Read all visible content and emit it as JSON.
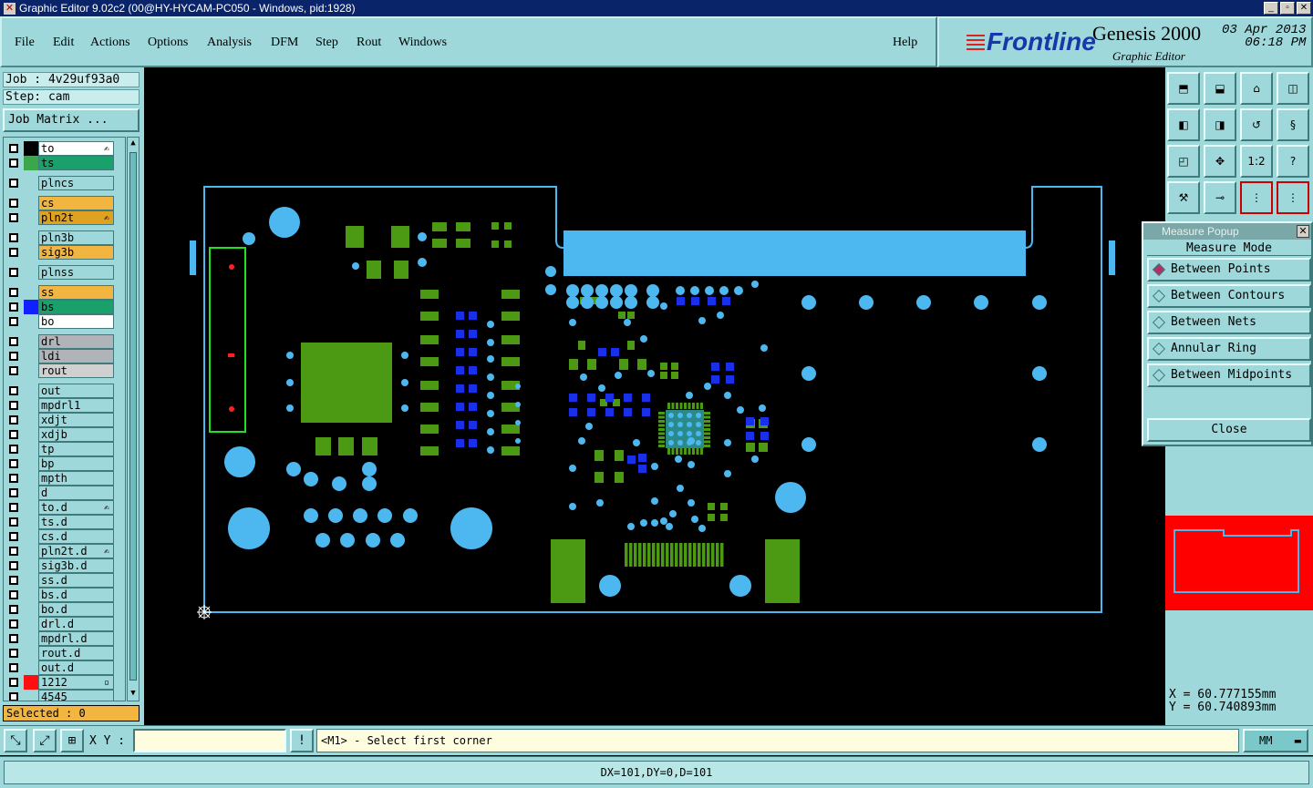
{
  "window": {
    "title": "Graphic Editor 9.02c2 (00@HY-HYCAM-PC050 - Windows, pid:1928)",
    "min": "_",
    "max": "▫",
    "close": "✕"
  },
  "menu": [
    "File",
    "Edit",
    "Actions",
    "Options",
    "Analysis",
    "DFM",
    "Step",
    "Rout",
    "Windows"
  ],
  "help": "Help",
  "brand": {
    "logo": "Frontline",
    "product": "Genesis 2000",
    "subtitle": "Graphic Editor",
    "date": "03 Apr 2013",
    "time": "06:18 PM"
  },
  "job": {
    "job": "Job : 4v29uf93a0",
    "step": "Step: cam",
    "matrix": "Job Matrix ..."
  },
  "layers": [
    {
      "name": "to",
      "color": "#ffffff",
      "swatch": "#000000",
      "mark": "✍"
    },
    {
      "name": "ts",
      "color": "#1aa06a",
      "swatch": "#3aa84a",
      "mark": ""
    },
    {
      "name": "plncs",
      "color": "#9ed8da",
      "swatch": "",
      "mark": ""
    },
    {
      "name": "cs",
      "color": "#f2b540",
      "swatch": "",
      "mark": ""
    },
    {
      "name": "pln2t",
      "color": "#e0a020",
      "swatch": "",
      "mark": "✍"
    },
    {
      "name": "pln3b",
      "color": "#9ed8da",
      "swatch": "",
      "mark": ""
    },
    {
      "name": "sig3b",
      "color": "#f2b540",
      "swatch": "",
      "mark": ""
    },
    {
      "name": "plnss",
      "color": "#9ed8da",
      "swatch": "",
      "mark": ""
    },
    {
      "name": "ss",
      "color": "#f2b540",
      "swatch": "",
      "mark": ""
    },
    {
      "name": "bs",
      "color": "#1aa06a",
      "swatch": "#1020ff",
      "mark": ""
    },
    {
      "name": "bo",
      "color": "#ffffff",
      "swatch": "",
      "mark": ""
    },
    {
      "name": "drl",
      "color": "#b0b4b8",
      "swatch": "",
      "mark": ""
    },
    {
      "name": "ldi",
      "color": "#b0b4b8",
      "swatch": "",
      "mark": ""
    },
    {
      "name": "rout",
      "color": "#d0d0d0",
      "swatch": "",
      "mark": ""
    },
    {
      "name": "out",
      "color": "#9ed8da",
      "swatch": "",
      "mark": ""
    },
    {
      "name": "mpdrl1",
      "color": "#9ed8da",
      "swatch": "",
      "mark": ""
    },
    {
      "name": "xdjt",
      "color": "#9ed8da",
      "swatch": "",
      "mark": ""
    },
    {
      "name": "xdjb",
      "color": "#9ed8da",
      "swatch": "",
      "mark": ""
    },
    {
      "name": "tp",
      "color": "#9ed8da",
      "swatch": "",
      "mark": ""
    },
    {
      "name": "bp",
      "color": "#9ed8da",
      "swatch": "",
      "mark": ""
    },
    {
      "name": "mpth",
      "color": "#9ed8da",
      "swatch": "",
      "mark": ""
    },
    {
      "name": "d",
      "color": "#9ed8da",
      "swatch": "",
      "mark": ""
    },
    {
      "name": "to.d",
      "color": "#9ed8da",
      "swatch": "",
      "mark": "✍"
    },
    {
      "name": "ts.d",
      "color": "#9ed8da",
      "swatch": "",
      "mark": ""
    },
    {
      "name": "cs.d",
      "color": "#9ed8da",
      "swatch": "",
      "mark": ""
    },
    {
      "name": "pln2t.d",
      "color": "#9ed8da",
      "swatch": "",
      "mark": "✍"
    },
    {
      "name": "sig3b.d",
      "color": "#9ed8da",
      "swatch": "",
      "mark": ""
    },
    {
      "name": "ss.d",
      "color": "#9ed8da",
      "swatch": "",
      "mark": ""
    },
    {
      "name": "bs.d",
      "color": "#9ed8da",
      "swatch": "",
      "mark": ""
    },
    {
      "name": "bo.d",
      "color": "#9ed8da",
      "swatch": "",
      "mark": ""
    },
    {
      "name": "drl.d",
      "color": "#9ed8da",
      "swatch": "",
      "mark": ""
    },
    {
      "name": "mpdrl.d",
      "color": "#9ed8da",
      "swatch": "",
      "mark": ""
    },
    {
      "name": "rout.d",
      "color": "#9ed8da",
      "swatch": "",
      "mark": ""
    },
    {
      "name": "out.d",
      "color": "#9ed8da",
      "swatch": "",
      "mark": ""
    },
    {
      "name": "1212",
      "color": "#9ed8da",
      "swatch": "#ff1010",
      "mark": "▫"
    },
    {
      "name": "4545",
      "color": "#9ed8da",
      "swatch": "",
      "mark": ""
    }
  ],
  "selected": "Selected : 0",
  "popup": {
    "title": "Measure Popup",
    "mode": "Measure Mode",
    "options": [
      "Between Points",
      "Between Contours",
      "Between Nets",
      "Annular Ring",
      "Between Midpoints"
    ],
    "active": 0,
    "close": "Close"
  },
  "coords": {
    "x": "X = 60.777155mm",
    "y": "Y = 60.740893mm"
  },
  "xy_label": "X Y :",
  "prompt": "<M1> - Select first corner",
  "unit": "MM",
  "status": "DX=101,DY=0,D=101",
  "toolbar_icons": [
    "zoom-home-icon",
    "zoom-fit-icon",
    "home-icon",
    "window-split-icon",
    "pan-left-icon",
    "pan-right-icon",
    "rotate-icon",
    "snake-icon",
    "zoom-out-icon",
    "zoom-in-icon",
    "scale-icon",
    "help-query-icon",
    "tools-icon",
    "probe-icon",
    "layer-display-icon",
    "layer-toggle-icon"
  ]
}
